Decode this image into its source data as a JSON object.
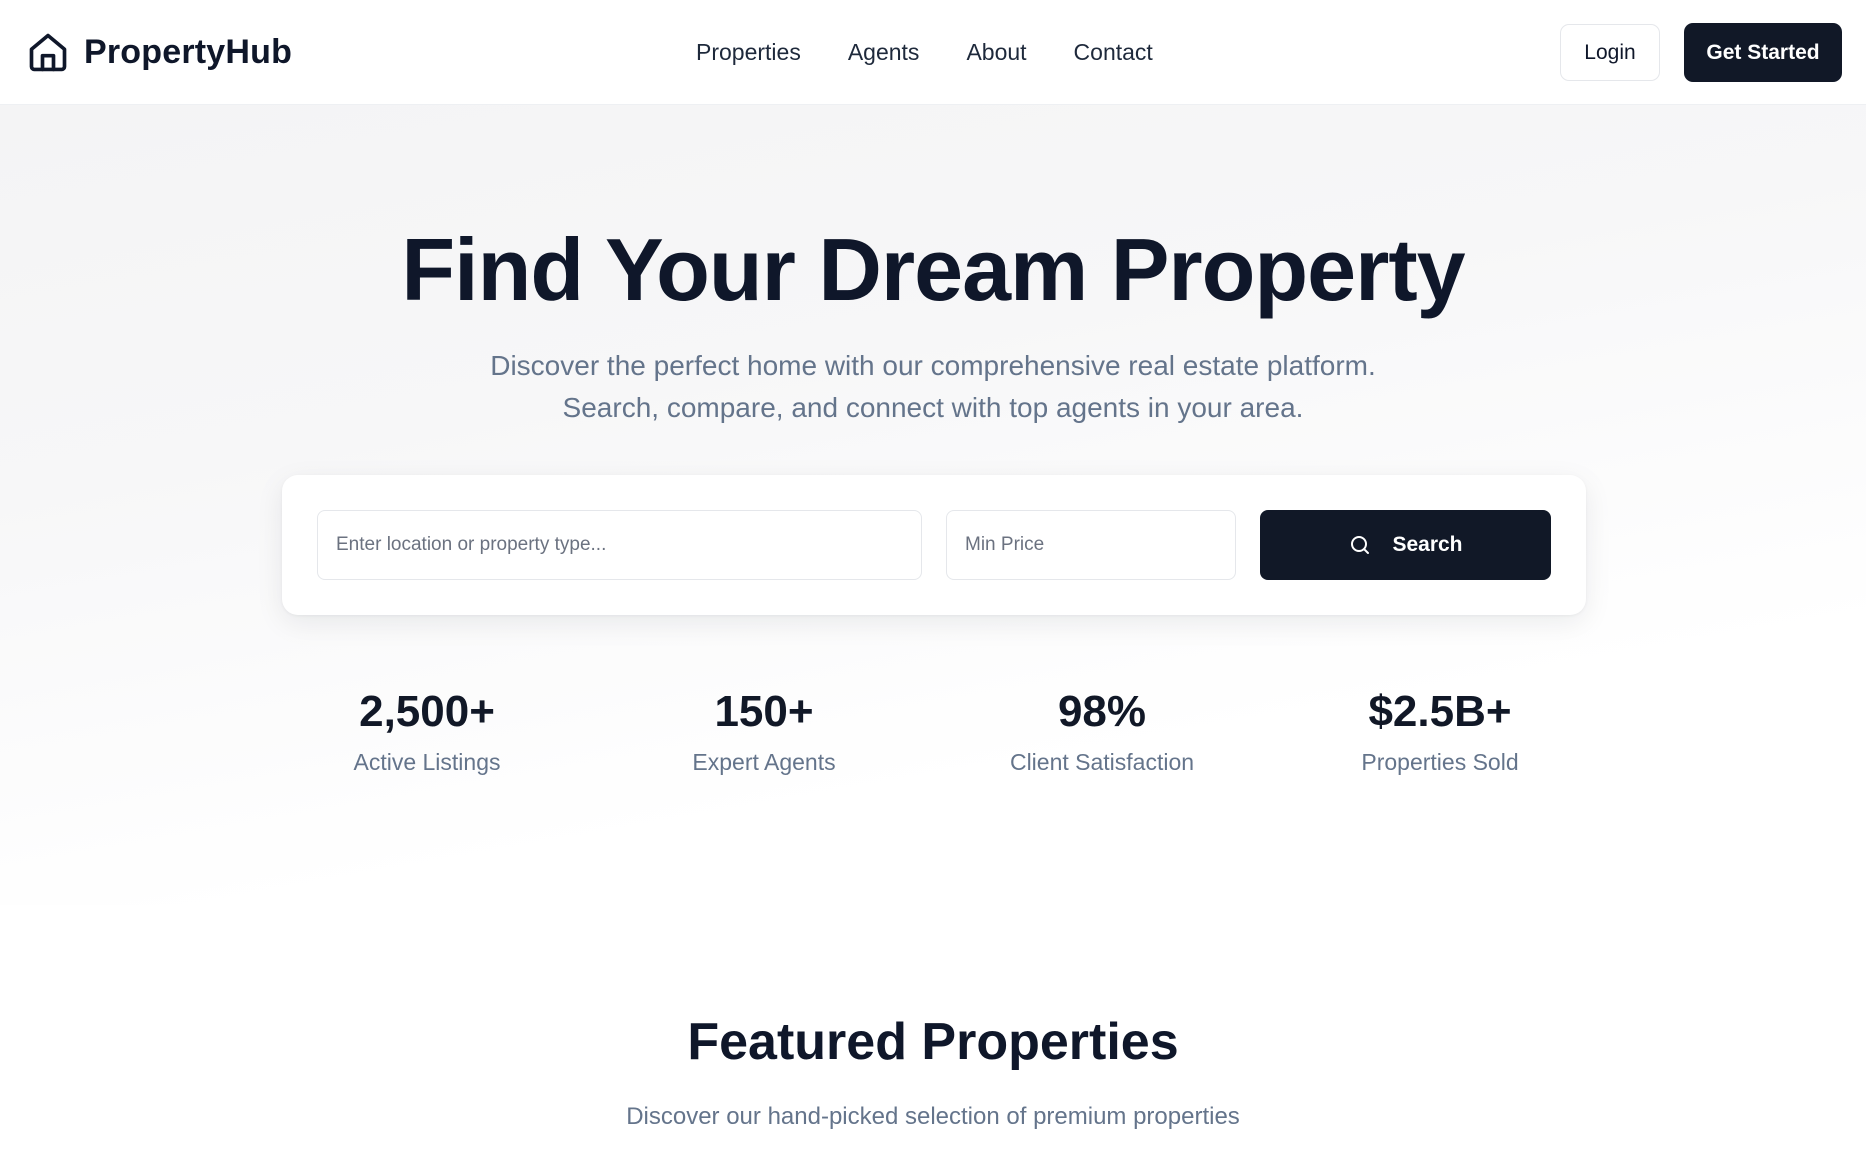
{
  "brand": {
    "name": "PropertyHub",
    "icon": "house-icon"
  },
  "nav": {
    "links": [
      "Properties",
      "Agents",
      "About",
      "Contact"
    ],
    "login_label": "Login",
    "get_started_label": "Get Started"
  },
  "hero": {
    "title": "Find Your Dream Property",
    "subtitle_line1": "Discover the perfect home with our comprehensive real estate platform.",
    "subtitle_line2": "Search, compare, and connect with top agents in your area."
  },
  "search": {
    "location_placeholder": "Enter location or property type...",
    "location_value": "",
    "min_price_placeholder": "Min Price",
    "min_price_value": "",
    "button_label": "Search",
    "button_icon": "search-icon"
  },
  "stats": [
    {
      "value": "2,500+",
      "label": "Active Listings"
    },
    {
      "value": "150+",
      "label": "Expert Agents"
    },
    {
      "value": "98%",
      "label": "Client Satisfaction"
    },
    {
      "value": "$2.5B+",
      "label": "Properties Sold"
    }
  ],
  "featured": {
    "title": "Featured Properties",
    "subtitle": "Discover our hand-picked selection of premium properties"
  },
  "colors": {
    "primary": "#111827",
    "text_muted": "#64748b",
    "border": "#e5e7eb"
  }
}
